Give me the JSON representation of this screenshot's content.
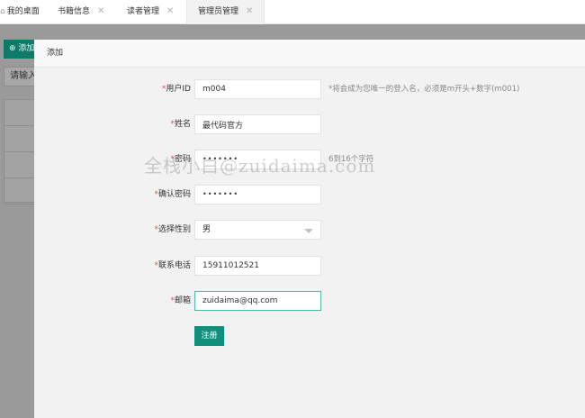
{
  "tabs": [
    {
      "label": "我的桌面",
      "glyph": "⌂",
      "closable": false
    },
    {
      "label": "书籍信息",
      "closable": true
    },
    {
      "label": "读者管理",
      "closable": true
    },
    {
      "label": "管理员管理",
      "closable": true,
      "active": true
    }
  ],
  "close_glyph": "✕",
  "background": {
    "add_button": "添加",
    "search_placeholder": "请输入"
  },
  "modal": {
    "title": "添加",
    "fields": {
      "userid": {
        "label": "用户ID",
        "value": "m004",
        "hint": "*将会成为您唯一的登入名，必须是m开头+数字(m001)"
      },
      "name": {
        "label": "姓名",
        "value": "最代码官方"
      },
      "password": {
        "label": "密码",
        "value": "•••••••",
        "hint": "6到16个字符"
      },
      "confirm": {
        "label": "确认密码",
        "value": "•••••••"
      },
      "gender": {
        "label": "选择性别",
        "value": "男"
      },
      "phone": {
        "label": "联系电话",
        "value": "15911012521"
      },
      "email": {
        "label": "邮箱",
        "value": "zuidaima@qq.com"
      }
    },
    "required_mark": "*",
    "submit_label": "注册"
  },
  "watermark": "全栈小白@zuidaima.com",
  "colors": {
    "accent": "#0f8f7c",
    "required": "#d9534f"
  }
}
